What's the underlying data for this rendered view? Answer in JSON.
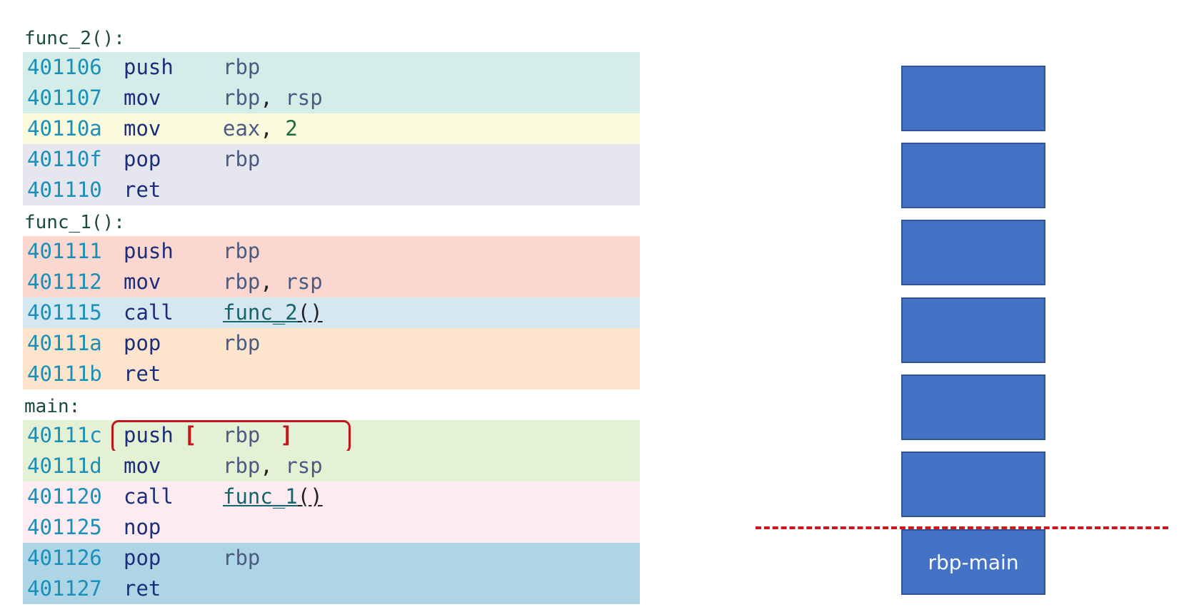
{
  "code": {
    "functions": [
      {
        "label": "func_2():",
        "rows": [
          {
            "addr": "401106",
            "mnem": "push",
            "op1": "rbp",
            "comma": "",
            "op2": "",
            "op2_type": "reg",
            "bg": "#d4ede8"
          },
          {
            "addr": "401107",
            "mnem": "mov",
            "op1": "rbp",
            "comma": ", ",
            "op2": "rsp",
            "op2_type": "reg",
            "bg": "#d4ede8"
          },
          {
            "addr": "40110a",
            "mnem": "mov",
            "op1": "eax",
            "comma": ", ",
            "op2": "2",
            "op2_type": "num",
            "bg": "#fafadc"
          },
          {
            "addr": "40110f",
            "mnem": "pop",
            "op1": "rbp",
            "comma": "",
            "op2": "",
            "op2_type": "reg",
            "bg": "#e6e6ee"
          },
          {
            "addr": "401110",
            "mnem": "ret",
            "op1": "",
            "comma": "",
            "op2": "",
            "op2_type": "reg",
            "bg": "#e6e6ee"
          }
        ]
      },
      {
        "label": "func_1():",
        "rows": [
          {
            "addr": "401111",
            "mnem": "push",
            "op1": "rbp",
            "comma": "",
            "op2": "",
            "op2_type": "reg",
            "bg": "#fad7cf"
          },
          {
            "addr": "401112",
            "mnem": "mov",
            "op1": "rbp",
            "comma": ", ",
            "op2": "rsp",
            "op2_type": "reg",
            "bg": "#fad7cf"
          },
          {
            "addr": "401115",
            "mnem": "call",
            "op1": "",
            "comma": "",
            "op2": "",
            "call_name": "func_2",
            "call_paren": "()",
            "op2_type": "call",
            "bg": "#d5e7f0"
          },
          {
            "addr": "40111a",
            "mnem": "pop",
            "op1": "rbp",
            "comma": "",
            "op2": "",
            "op2_type": "reg",
            "bg": "#fce5cc"
          },
          {
            "addr": "40111b",
            "mnem": "ret",
            "op1": "",
            "comma": "",
            "op2": "",
            "op2_type": "reg",
            "bg": "#fce5cc"
          }
        ]
      },
      {
        "label": "main:",
        "rows": [
          {
            "addr": "40111c",
            "mnem": "push",
            "op1": "rbp",
            "comma": "",
            "op2": "",
            "op2_type": "reg",
            "bg": "#e4f1d5",
            "highlight": true,
            "bracket_open": "[",
            "bracket_close": "]"
          },
          {
            "addr": "40111d",
            "mnem": "mov",
            "op1": "rbp",
            "comma": ", ",
            "op2": "rsp",
            "op2_type": "reg",
            "bg": "#e4f1d5"
          },
          {
            "addr": "401120",
            "mnem": "call",
            "op1": "",
            "comma": "",
            "op2": "",
            "call_name": "func_1",
            "call_paren": "()",
            "op2_type": "call",
            "bg": "#fcecf2"
          },
          {
            "addr": "401125",
            "mnem": "nop",
            "op1": "",
            "comma": "",
            "op2": "",
            "op2_type": "reg",
            "bg": "#fcecf2"
          },
          {
            "addr": "401126",
            "mnem": "pop",
            "op1": "rbp",
            "comma": "",
            "op2": "",
            "op2_type": "reg",
            "bg": "#aed5e6"
          },
          {
            "addr": "401127",
            "mnem": "ret",
            "op1": "",
            "comma": "",
            "op2": "",
            "op2_type": "reg",
            "bg": "#aed5e6"
          }
        ]
      }
    ]
  },
  "stack": {
    "slots": [
      {
        "label": ""
      },
      {
        "label": ""
      },
      {
        "label": ""
      },
      {
        "label": ""
      },
      {
        "label": ""
      },
      {
        "label": ""
      },
      {
        "label": "rbp-main"
      }
    ],
    "slot_color": "#4472c4",
    "divider_color": "#c9191f"
  }
}
